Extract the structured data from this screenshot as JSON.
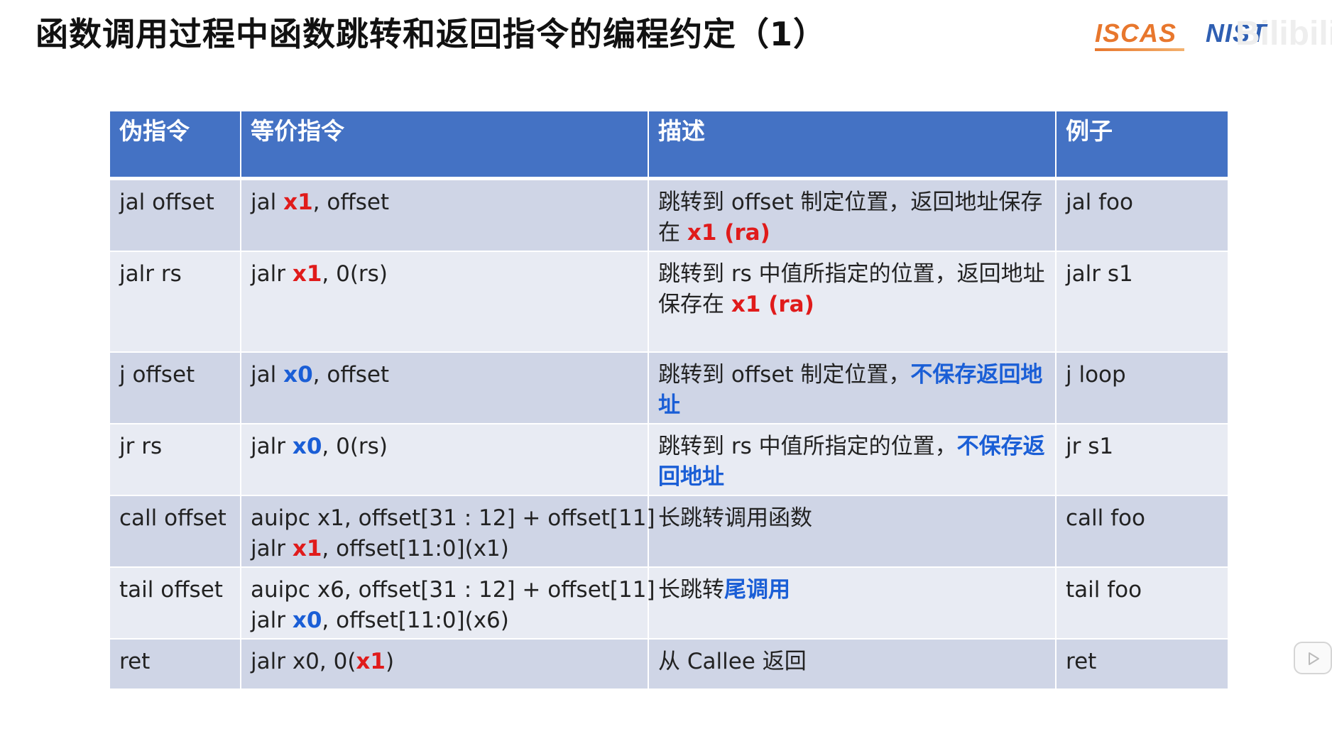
{
  "title": "函数调用过程中函数跳转和返回指令的编程约定（1）",
  "logos": {
    "left": "ISCAS",
    "right": "NIST",
    "watermark": "Bilibili"
  },
  "table": {
    "headers": [
      "伪指令",
      "等价指令",
      "描述",
      "例子"
    ],
    "rows": [
      {
        "pseudo": "jal offset",
        "equiv": [
          [
            {
              "t": "jal "
            },
            {
              "t": "x1",
              "c": "red"
            },
            {
              "t": ", offset"
            }
          ]
        ],
        "desc": [
          {
            "t": "跳转到 offset 制定位置，返回地址保存在 "
          },
          {
            "t": "x1 (ra)",
            "c": "red"
          }
        ],
        "example": "jal foo"
      },
      {
        "pseudo": "jalr rs",
        "equiv": [
          [
            {
              "t": "jalr "
            },
            {
              "t": "x1",
              "c": "red"
            },
            {
              "t": ", 0(rs)"
            }
          ]
        ],
        "desc": [
          {
            "t": "跳转到 rs 中值所指定的位置，返回地址保存在 "
          },
          {
            "t": "x1 (ra)",
            "c": "red"
          }
        ],
        "example": "jalr s1"
      },
      {
        "pseudo": "j offset",
        "equiv": [
          [
            {
              "t": "jal "
            },
            {
              "t": "x0",
              "c": "blue"
            },
            {
              "t": ", offset"
            }
          ]
        ],
        "desc": [
          {
            "t": "跳转到 offset 制定位置，"
          },
          {
            "t": "不保存返回地址",
            "c": "blue"
          }
        ],
        "example": "j loop"
      },
      {
        "pseudo": "jr rs",
        "equiv": [
          [
            {
              "t": "jalr "
            },
            {
              "t": "x0",
              "c": "blue"
            },
            {
              "t": ", 0(rs)"
            }
          ]
        ],
        "desc": [
          {
            "t": "跳转到 rs 中值所指定的位置，"
          },
          {
            "t": "不保存返回地址",
            "c": "blue"
          }
        ],
        "example": "jr s1"
      },
      {
        "pseudo": "call offset",
        "equiv": [
          [
            {
              "t": "auipc x1, offset[31 : 12] + offset[11]"
            }
          ],
          [
            {
              "t": "jalr "
            },
            {
              "t": "x1",
              "c": "red"
            },
            {
              "t": ", offset[11:0](x1)"
            }
          ]
        ],
        "desc": [
          {
            "t": "长跳转调用函数"
          }
        ],
        "example": "call foo"
      },
      {
        "pseudo": "tail offset",
        "equiv": [
          [
            {
              "t": "auipc x6, offset[31 : 12] + offset[11]"
            }
          ],
          [
            {
              "t": "jalr "
            },
            {
              "t": "x0",
              "c": "blue"
            },
            {
              "t": ", offset[11:0](x6)"
            }
          ]
        ],
        "desc": [
          {
            "t": "长跳转"
          },
          {
            "t": "尾调用",
            "c": "blue"
          }
        ],
        "example": "tail foo"
      },
      {
        "pseudo": "ret",
        "equiv": [
          [
            {
              "t": "jalr x0, 0("
            },
            {
              "t": "x1",
              "c": "red"
            },
            {
              "t": ")"
            }
          ]
        ],
        "desc": [
          {
            "t": "从 Callee 返回"
          }
        ],
        "example": "ret"
      }
    ]
  },
  "colors": {
    "header_bg": "#4472c4",
    "row_odd": "#cfd5e6",
    "row_even": "#e8ebf3",
    "highlight_red": "#e01b1b",
    "highlight_blue": "#1a5ed6"
  },
  "icons": {
    "play": "play-icon"
  }
}
